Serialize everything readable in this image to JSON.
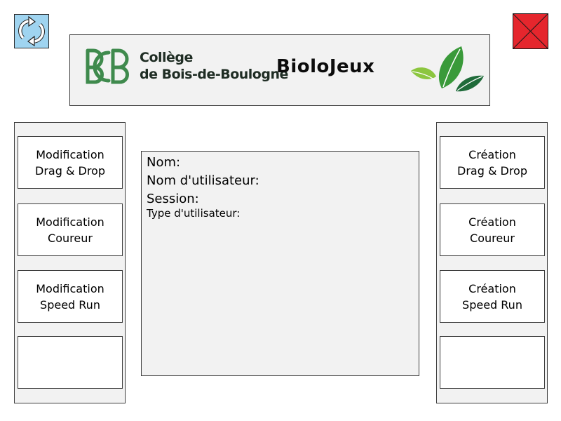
{
  "header": {
    "college_line1": "Collège",
    "college_line2": "de Bois-de-Boulogne",
    "app_title": "BioloJeux",
    "logo_initials": "BCB"
  },
  "toolbar": {
    "refresh_icon": "refresh-icon",
    "close_icon": "close-icon",
    "close_color": "#e5262d",
    "refresh_color": "#9fd4f0"
  },
  "left_panel": {
    "buttons": [
      {
        "line1": "Modification",
        "line2": "Drag & Drop"
      },
      {
        "line1": "Modification",
        "line2": "Coureur"
      },
      {
        "line1": "Modification",
        "line2": "Speed Run"
      },
      {
        "line1": "",
        "line2": ""
      }
    ]
  },
  "right_panel": {
    "buttons": [
      {
        "line1": "Création",
        "line2": "Drag & Drop"
      },
      {
        "line1": "Création",
        "line2": "Coureur"
      },
      {
        "line1": "Création",
        "line2": "Speed Run"
      },
      {
        "line1": "",
        "line2": ""
      }
    ]
  },
  "profile": {
    "name_label": "Nom:",
    "username_label": "Nom d'utilisateur:",
    "session_label": "Session:",
    "user_type_label": "Type d'utilisateur:"
  },
  "colors": {
    "logo_green": "#3f8a4d",
    "leaf_light": "#8cc63f",
    "leaf_mid": "#3a9a3a",
    "leaf_dark": "#1f6b3a"
  }
}
